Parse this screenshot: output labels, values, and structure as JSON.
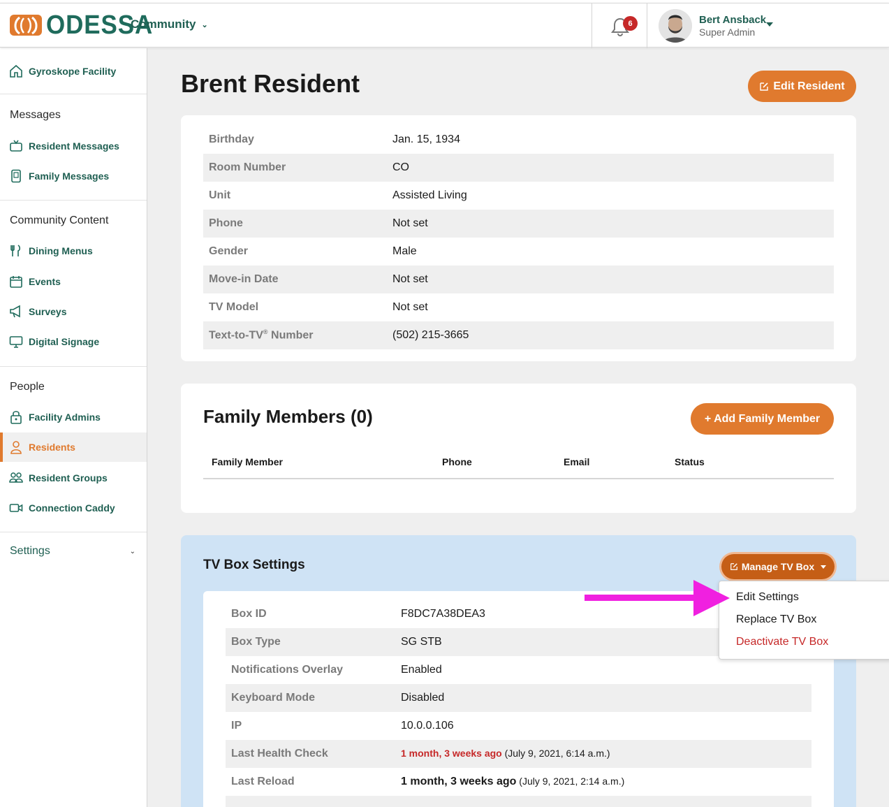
{
  "header": {
    "logo_text": "ODESSA",
    "community_label": "Community",
    "notification_count": "6",
    "user_name": "Bert Ansback",
    "user_role": "Super Admin",
    "brand_color": "#1f6b5c",
    "accent_color": "#e07a2e"
  },
  "sidebar": {
    "facility": "Gyroskope Facility",
    "sections": {
      "messages": "Messages",
      "community_content": "Community Content",
      "people": "People"
    },
    "items": {
      "resident_messages": "Resident Messages",
      "family_messages": "Family Messages",
      "dining_menus": "Dining Menus",
      "events": "Events",
      "surveys": "Surveys",
      "digital_signage": "Digital Signage",
      "facility_admins": "Facility Admins",
      "residents": "Residents",
      "resident_groups": "Resident Groups",
      "connection_caddy": "Connection Caddy"
    },
    "settings": "Settings",
    "active_item": "Residents"
  },
  "main": {
    "title": "Brent Resident",
    "edit_button": "Edit Resident",
    "details": [
      {
        "label": "Birthday",
        "value": "Jan. 15, 1934"
      },
      {
        "label": "Room Number",
        "value": "CO"
      },
      {
        "label": "Unit",
        "value": "Assisted Living"
      },
      {
        "label": "Phone",
        "value": "Not set"
      },
      {
        "label": "Gender",
        "value": "Male"
      },
      {
        "label": "Move-in Date",
        "value": "Not set"
      },
      {
        "label": "TV Model",
        "value": "Not set"
      },
      {
        "label": "Text-to-TV",
        "label_sup": "®",
        "label_suffix": " Number",
        "value": "(502) 215-3665"
      }
    ],
    "family": {
      "title": "Family Members (0)",
      "add_button": "+  Add Family Member",
      "columns": [
        "Family Member",
        "Phone",
        "Email",
        "Status"
      ]
    },
    "tv_box": {
      "title": "TV Box Settings",
      "manage_button": "Manage TV Box",
      "rows": [
        {
          "label": "Box ID",
          "value": "F8DC7A38DEA3"
        },
        {
          "label": "Box Type",
          "value": "SG STB"
        },
        {
          "label": "Notifications Overlay",
          "value": "Enabled"
        },
        {
          "label": "Keyboard Mode",
          "value": "Disabled"
        },
        {
          "label": "IP",
          "value": "10.0.0.106"
        },
        {
          "label": "Last Health Check",
          "value_strong": "1 month, 3 weeks ago",
          "value_note": " (July 9, 2021, 6:14 a.m.)"
        },
        {
          "label": "Last Reload",
          "value_strong": "1 month, 3 weeks ago",
          "value_note": " (July 9, 2021, 2:14 a.m.)"
        }
      ]
    },
    "dropdown": {
      "items": [
        "Edit Settings",
        "Replace TV Box",
        "Deactivate TV Box"
      ]
    }
  }
}
